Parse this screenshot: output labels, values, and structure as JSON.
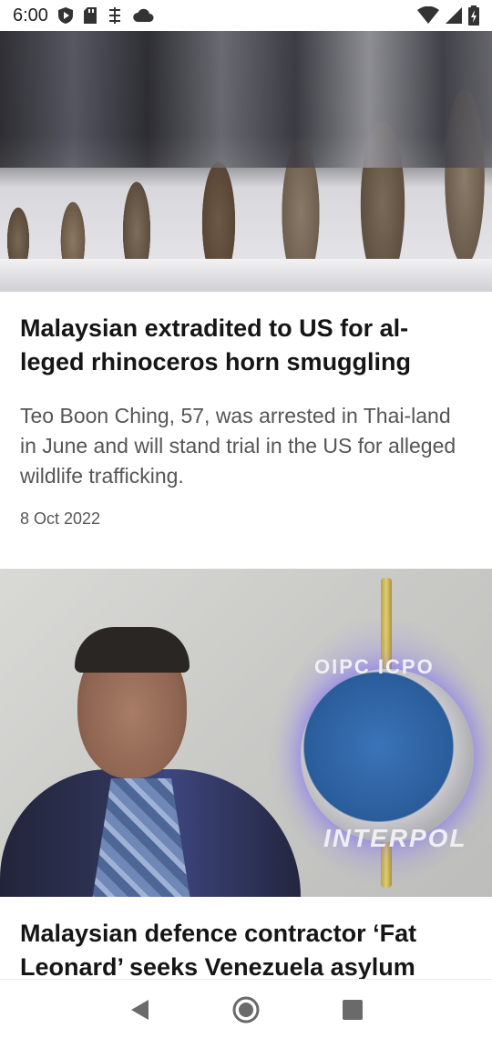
{
  "status_bar": {
    "time": "6:00",
    "left_icons": [
      "shield-play-icon",
      "sd-card-icon",
      "data-saver-icon",
      "cloud-icon"
    ],
    "right_icons": [
      "wifi-icon",
      "cell-signal-icon",
      "battery-icon"
    ]
  },
  "articles": [
    {
      "image_name": "rhino-horns-photo",
      "title": "Malaysian extradited to US for al-leged rhinoceros horn smuggling",
      "summary": "Teo Boon Ching, 57, was arrested in Thai-land in June and will stand trial in the US for alleged wildlife trafficking.",
      "date": "8 Oct 2022"
    },
    {
      "image_name": "fat-leonard-interpol-photo",
      "image_text_top": "OIPC ICPO",
      "image_text_bottom": "INTERPOL",
      "title": "Malaysian defence contractor ‘Fat Leonard’ seeks Venezuela asylum"
    }
  ],
  "nav_bar": {
    "back_icon": "back-triangle-icon",
    "home_icon": "home-circle-icon",
    "recents_icon": "recents-square-icon"
  }
}
